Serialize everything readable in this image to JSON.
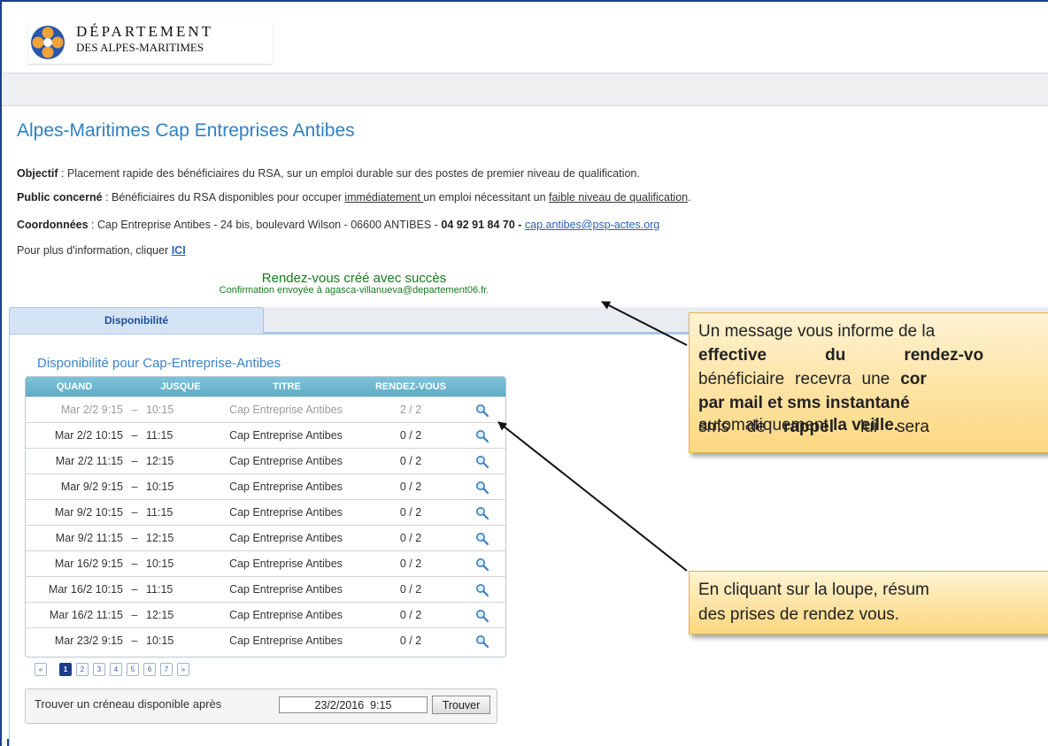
{
  "header": {
    "logo_line1": "DÉPARTEMENT",
    "logo_line2": "DES ALPES-MARITIMES"
  },
  "page": {
    "title": "Alpes-Maritimes Cap Entreprises Antibes",
    "objectif_label": "Objectif",
    "objectif_text": " : Placement rapide des bénéficiaires du RSA, sur un emploi durable sur des postes de premier niveau de qualification.",
    "public_label": "Public concerné",
    "public_text_1": " : Bénéficiaires du RSA disponibles pour occuper ",
    "public_link_1": "immédiatement ",
    "public_text_2": "un emploi nécessitant un ",
    "public_link_2": "faible niveau de qualification",
    "public_text_3": ".",
    "coord_label": "Coordonnées",
    "coord_text": " : Cap Entreprise Antibes - 24 bis, boulevard Wilson - 06600 ANTIBES - ",
    "coord_phone": "04 92 91 84 70 -",
    "coord_email": "cap.antibes@psp-actes.org",
    "info_text": "Pour plus d'information, cliquer ",
    "info_link": "ICI"
  },
  "success": {
    "title": "Rendez-vous créé avec succès",
    "detail": "Confirmation envoyée à agasca-villanueva@departement06.fr."
  },
  "tabs": {
    "active": "Disponibilité"
  },
  "availability": {
    "title": "Disponibilité pour Cap-Entreprise-Antibes",
    "columns": [
      "QUAND",
      "JUSQUE",
      "TITRE",
      "RENDEZ-VOUS"
    ],
    "rows": [
      {
        "start": "Mar 2/2 9:15",
        "dash": "–",
        "end": "10:15",
        "title": "Cap Entreprise Antibes",
        "rdv": "2 / 2"
      },
      {
        "start": "Mar 2/2 10:15",
        "dash": "–",
        "end": "11:15",
        "title": "Cap Entreprise Antibes",
        "rdv": "0 / 2"
      },
      {
        "start": "Mar 2/2 11:15",
        "dash": "–",
        "end": "12:15",
        "title": "Cap Entreprise Antibes",
        "rdv": "0 / 2"
      },
      {
        "start": "Mar 9/2 9:15",
        "dash": "–",
        "end": "10:15",
        "title": "Cap Entreprise Antibes",
        "rdv": "0 / 2"
      },
      {
        "start": "Mar 9/2 10:15",
        "dash": "–",
        "end": "11:15",
        "title": "Cap Entreprise Antibes",
        "rdv": "0 / 2"
      },
      {
        "start": "Mar 9/2 11:15",
        "dash": "–",
        "end": "12:15",
        "title": "Cap Entreprise Antibes",
        "rdv": "0 / 2"
      },
      {
        "start": "Mar 16/2 9:15",
        "dash": "–",
        "end": "10:15",
        "title": "Cap Entreprise Antibes",
        "rdv": "0 / 2"
      },
      {
        "start": "Mar 16/2 10:15",
        "dash": "–",
        "end": "11:15",
        "title": "Cap Entreprise Antibes",
        "rdv": "0 / 2"
      },
      {
        "start": "Mar 16/2 11:15",
        "dash": "–",
        "end": "12:15",
        "title": "Cap Entreprise Antibes",
        "rdv": "0 / 2"
      },
      {
        "start": "Mar 23/2 9:15",
        "dash": "–",
        "end": "10:15",
        "title": "Cap Entreprise Antibes",
        "rdv": "0 / 2"
      }
    ],
    "row_icon": "search-icon"
  },
  "pagination": {
    "prev": "«",
    "pages": [
      "1",
      "2",
      "3",
      "4",
      "5",
      "6",
      "7"
    ],
    "current": "1",
    "next": "»"
  },
  "search": {
    "label": "Trouver un créneau disponible après",
    "value": "23/2/2016  9:15",
    "button": "Trouver"
  },
  "callouts": {
    "c1_l1": "Un message vous informe de la",
    "c1_l2a": "effective",
    "c1_l2b": "du",
    "c1_l2c": "rendez-vo",
    "c1_l3a": "bénéficiaire",
    "c1_l3b": "recevra",
    "c1_l3c": "une",
    "c1_l3d": "cor",
    "c1_l4": "par mail et sms instantané",
    "c1_l5a": "sms",
    "c1_l5b": "de",
    "c1_l5c": "rappel",
    "c1_l5d": "lui",
    "c1_l5e": "sera",
    "c1_l6a": "automatiquement ",
    "c1_l6b": "la veille.",
    "c2_l1": "En cliquant sur la loupe, résum",
    "c2_l2": "des prises de rendez vous."
  },
  "colors": {
    "title_blue": "#2e80c3",
    "success_green": "#187a1e",
    "table_header": "#6fb7cf",
    "callout_bg": "#fbd77f",
    "page_active": "#1c3e88"
  }
}
